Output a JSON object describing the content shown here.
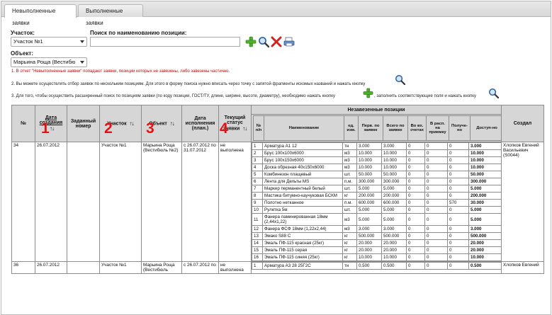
{
  "tabs": [
    {
      "label": "Невыполненные заявки",
      "active": true
    },
    {
      "label": "Выполненные заявки",
      "active": false
    }
  ],
  "filters": {
    "uchastok_label": "Участок:",
    "uchastok_value": "Участок №1",
    "search_label": "Поиск по наименованию позиции:",
    "search_value": "",
    "object_label": "Объект:",
    "object_value": "Марьина Роща (Вестибю"
  },
  "notes": {
    "n1": "1. В отчет \"Невыполненные заявки\" попадают заявки, позиции которых не завезены, либо завезены частично.",
    "n2": "2. Вы можете осуществлять отбор заявок по нескольким позициям. Для этого в форму поиска нужно вписать через точку с запятой фрагменты искомых названий и нажать кнопку",
    "n3a": "3. Для того, чтобы осуществить расширенный поиск по позициям заявки (по коду позиции, ГОСТ/ТУ, длине, ширине, высоте, диаметру), необходимо нажать кнопку",
    "n3b": ", заполнить соответствующие поля и нажать кнопку"
  },
  "table": {
    "headers": {
      "num": "№",
      "date": "Дата создания",
      "task": "Заданный номер",
      "uchastok": "Участок",
      "object": "Объект",
      "exec": "Дата исполнения (план.)",
      "status": "Текущий статус заявки",
      "positions": "Незавезенные позиции",
      "created": "Создал"
    },
    "inner_headers": [
      "№ п/п",
      "Наименование",
      "ед. изм.",
      "Перв. по заявке",
      "Всего по заявке",
      "Во вх. счетах",
      "В расп. на приемку",
      "Получе-но",
      "Доступ-но"
    ],
    "red_marks": [
      "1",
      "2",
      "3",
      "4"
    ],
    "rows": [
      {
        "num": "34",
        "date": "26.07.2012",
        "task": "",
        "uchastok": "Участок №1",
        "object": "Марьина Роща (Вестибюль №2)",
        "exec": "с 26.07.2012 по 31.07.2012",
        "status": "не выполнена",
        "created": "Хлопков Евгений Васильевич (S0044)",
        "items": [
          {
            "n": "1",
            "name": "Арматура А1 12",
            "unit": "тн",
            "first": "3.000",
            "total": "3.000",
            "inv": "0",
            "acc": "0",
            "got": "0",
            "avail": "3.000"
          },
          {
            "n": "2",
            "name": "Брус 100х100х6000",
            "unit": "м3",
            "first": "10.000",
            "total": "10.000",
            "inv": "0",
            "acc": "0",
            "got": "0",
            "avail": "10.000"
          },
          {
            "n": "3",
            "name": "Брус 100х150х6000",
            "unit": "м3",
            "first": "10.000",
            "total": "10.000",
            "inv": "0",
            "acc": "0",
            "got": "0",
            "avail": "10.000"
          },
          {
            "n": "4",
            "name": "Доска обрезная 40х150х6000",
            "unit": "м3",
            "first": "10.000",
            "total": "10.000",
            "inv": "0",
            "acc": "0",
            "got": "0",
            "avail": "10.000"
          },
          {
            "n": "5",
            "name": "Комбинезон плащевый",
            "unit": "шт.",
            "first": "50.000",
            "total": "50.000",
            "inv": "0",
            "acc": "0",
            "got": "0",
            "avail": "50.000"
          },
          {
            "n": "6",
            "name": "Лента для Дельты MS",
            "unit": "п.м.",
            "first": "300.000",
            "total": "300.000",
            "inv": "0",
            "acc": "0",
            "got": "0",
            "avail": "300.000"
          },
          {
            "n": "7",
            "name": "Маркер перманентный белый",
            "unit": "шт.",
            "first": "5.000",
            "total": "5.000",
            "inv": "0",
            "acc": "0",
            "got": "0",
            "avail": "5.000"
          },
          {
            "n": "8",
            "name": "Мастика битумно-каучуковая БСКМ",
            "unit": "кг",
            "first": "200.000",
            "total": "200.000",
            "inv": "0",
            "acc": "0",
            "got": "0",
            "avail": "200.000"
          },
          {
            "n": "9",
            "name": "Полотно нетканное",
            "unit": "п.м.",
            "first": "600.000",
            "total": "600.000",
            "inv": "0",
            "acc": "0",
            "got": "570",
            "avail": "30.000"
          },
          {
            "n": "10",
            "name": "Рулетка 5м",
            "unit": "шт.",
            "first": "5.000",
            "total": "5.000",
            "inv": "0",
            "acc": "0",
            "got": "0",
            "avail": "5.000"
          },
          {
            "n": "11",
            "name": "Фанера ламинированная 18мм (2,44х1,22)",
            "unit": "м3",
            "first": "5.000",
            "total": "5.000",
            "inv": "0",
            "acc": "0",
            "got": "0",
            "avail": "5.000"
          },
          {
            "n": "12",
            "name": "Фанера ФСФ 18мм (1,22х2,44)",
            "unit": "м3",
            "first": "3.000",
            "total": "3.000",
            "inv": "0",
            "acc": "0",
            "got": "0",
            "avail": "3.000"
          },
          {
            "n": "13",
            "name": "Эмако S88 C",
            "unit": "кг",
            "first": "500.000",
            "total": "500.000",
            "inv": "0",
            "acc": "0",
            "got": "0",
            "avail": "500.000"
          },
          {
            "n": "14",
            "name": "Эмаль ПФ-115 красная (25кг)",
            "unit": "кг",
            "first": "20.000",
            "total": "20.000",
            "inv": "0",
            "acc": "0",
            "got": "0",
            "avail": "20.000"
          },
          {
            "n": "15",
            "name": "Эмаль ПФ-115 серая",
            "unit": "кг",
            "first": "20.000",
            "total": "20.000",
            "inv": "0",
            "acc": "0",
            "got": "0",
            "avail": "20.000"
          },
          {
            "n": "16",
            "name": "Эмаль ПФ-115 синяя (25кг)",
            "unit": "кг",
            "first": "10.000",
            "total": "10.000",
            "inv": "0",
            "acc": "0",
            "got": "0",
            "avail": "10.000"
          }
        ]
      },
      {
        "num": "36",
        "date": "26.07.2012",
        "task": "",
        "uchastok": "Участок №1",
        "object": "Марьина Роща (Вестибюль",
        "exec": "с 26.07.2012 по",
        "status": "не выполнена",
        "created": "Хлопков Евгений",
        "items": [
          {
            "n": "1",
            "name": "Арматура А3 28 25Г2С",
            "unit": "тн",
            "first": "0.500",
            "total": "0.500",
            "inv": "0",
            "acc": "0",
            "got": "0",
            "avail": "0.500"
          }
        ]
      }
    ]
  },
  "colors": {
    "accent_red": "#e81010",
    "header_gray": "#d6d6d6",
    "note_red": "#d40000"
  }
}
